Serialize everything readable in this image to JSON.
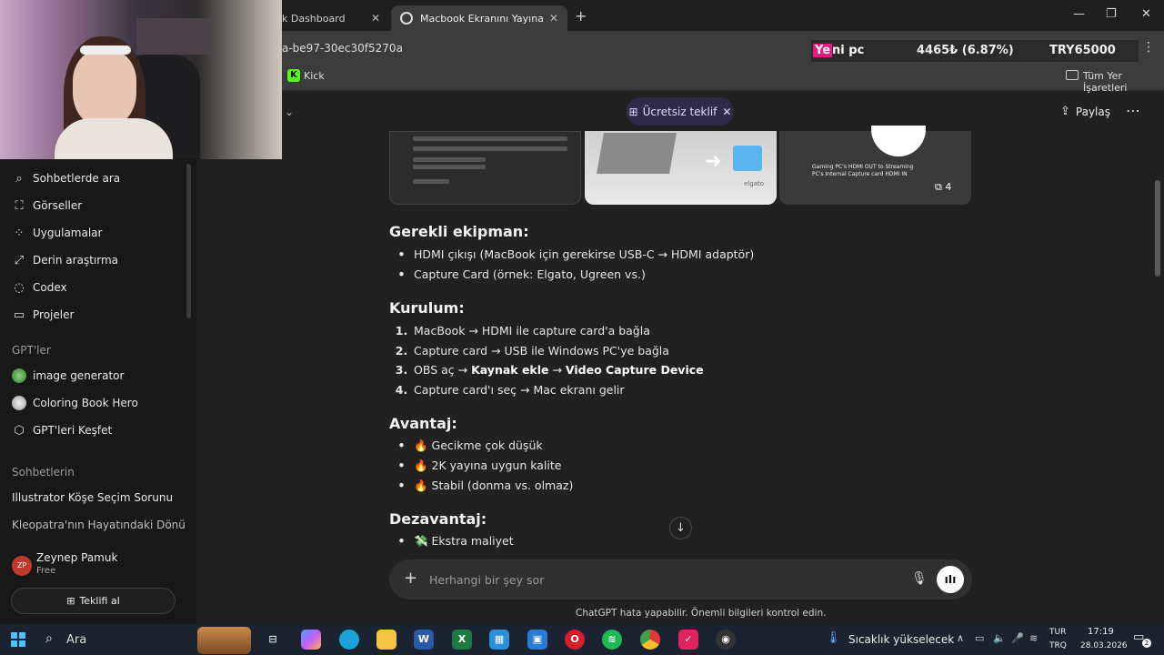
{
  "browser": {
    "tabs": [
      {
        "label": "k Dashboard"
      },
      {
        "label": "Macbook Ekranını Yayına Aktarı"
      }
    ],
    "url": "a-be97-30ec30f5270a",
    "ticker": {
      "name_highlight": "Ye",
      "name_rest": "ni pc",
      "value": "4465₺ (6.87%)",
      "symbol": "TRY65000"
    },
    "bookmarks": [
      {
        "label": "Kick"
      }
    ],
    "all_bookmarks": "Tüm Yer İşaretleri"
  },
  "sidebar": {
    "items": [
      {
        "label": "Sohbetlerde ara",
        "icon": "search-icon"
      },
      {
        "label": "Görseller",
        "icon": "image-icon"
      },
      {
        "label": "Uygulamalar",
        "icon": "apps-icon"
      },
      {
        "label": "Derin araştırma",
        "icon": "telescope-icon"
      },
      {
        "label": "Codex",
        "icon": "codex-icon"
      },
      {
        "label": "Projeler",
        "icon": "folder-icon"
      }
    ],
    "gpts_heading": "GPT'ler",
    "gpts": [
      {
        "label": "image generator"
      },
      {
        "label": "Coloring Book Hero"
      },
      {
        "label": "GPT'leri Keşfet"
      }
    ],
    "chats_heading": "Sohbetlerin",
    "chats": [
      {
        "label": "Illustrator Köşe Seçim Sorunu"
      },
      {
        "label": "Kleopatra'nın Hayatındaki Dönü..."
      }
    ],
    "user": {
      "initials": "ZP",
      "name": "Zeynep Pamuk",
      "plan": "Free"
    },
    "invite_label": "Teklifi al"
  },
  "header": {
    "offer_label": "Ücretsiz teklif",
    "share_label": "Paylaş"
  },
  "images": {
    "thumb3_caption": "Gaming PC's HDMI OUT to Streaming PC's Internal Capture card HDMI IN",
    "thumb2_brand": "elgato",
    "more_count": "4"
  },
  "answer": {
    "equipment": {
      "title": "Gerekli ekipman:",
      "items": [
        "HDMI çıkışı (MacBook için gerekirse USB-C → HDMI adaptör)",
        "Capture Card (örnek: Elgato, Ugreen vs.)"
      ]
    },
    "setup": {
      "title": "Kurulum:",
      "steps": [
        {
          "num": "1.",
          "text": "MacBook → HDMI ile capture card'a bağla"
        },
        {
          "num": "2.",
          "text": "Capture card → USB ile Windows PC'ye bağla"
        },
        {
          "num": "3.",
          "pre": "OBS aç → ",
          "bold1": "Kaynak ekle",
          "mid": " → ",
          "bold2": "Video Capture Device"
        },
        {
          "num": "4.",
          "text": "Capture card'ı seç → Mac ekranı gelir"
        }
      ]
    },
    "pros": {
      "title": "Avantaj:",
      "items": [
        "🔥 Gecikme çok düşük",
        "🔥 2K yayına uygun kalite",
        "🔥 Stabil (donma vs. olmaz)"
      ]
    },
    "cons": {
      "title": "Dezavantaj:",
      "items": [
        "💸 Ekstra maliyet"
      ]
    }
  },
  "composer": {
    "placeholder": "Herhangi bir şey sor",
    "disclaimer": "ChatGPT hata yapabilir. Önemli bilgileri kontrol edin."
  },
  "taskbar": {
    "search_label": "Ara",
    "weather": "Sıcaklık yükselecek",
    "lang1": "TUR",
    "lang2": "TRQ",
    "time": "17:19",
    "date": "28.03.2026",
    "notif_count": "2"
  }
}
